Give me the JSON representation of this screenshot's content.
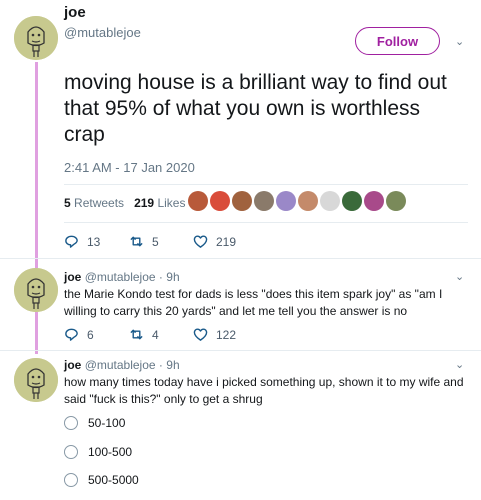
{
  "main_tweet": {
    "name": "joe",
    "handle": "@mutablejoe",
    "follow_label": "Follow",
    "text": "moving house is a brilliant way to find out that 95% of what you own is worthless crap",
    "timestamp": "2:41 AM - 17 Jan 2020",
    "retweets_count": "5",
    "retweets_label": "Retweets",
    "likes_count": "219",
    "likes_label": "Likes",
    "liker_colors": [
      "#b85a3a",
      "#d94c3a",
      "#a0623e",
      "#8a7a6a",
      "#9a88c8",
      "#c48a6a",
      "#d8d8d8",
      "#3a6a3a",
      "#a84a8a",
      "#7a8a5a"
    ],
    "actions": {
      "replies": "13",
      "retweets": "5",
      "likes": "219"
    }
  },
  "replies": [
    {
      "name": "joe",
      "handle": "@mutablejoe",
      "time": "9h",
      "text": "the Marie Kondo test for dads is less \"does this item spark joy\" as \"am I willing to carry this 20 yards\" and let me tell you the answer is no",
      "actions": {
        "replies": "6",
        "retweets": "4",
        "likes": "122"
      }
    },
    {
      "name": "joe",
      "handle": "@mutablejoe",
      "time": "9h",
      "text": "how many times today have i picked something up, shown it to my wife and said \"fuck is this?\" only to get a shrug",
      "poll_options": [
        "50-100",
        "100-500",
        "500-5000"
      ]
    }
  ],
  "separator": "·",
  "colors": {
    "accent": "#a020a0",
    "thread_line": "#e0a0e0",
    "muted": "#657786"
  }
}
